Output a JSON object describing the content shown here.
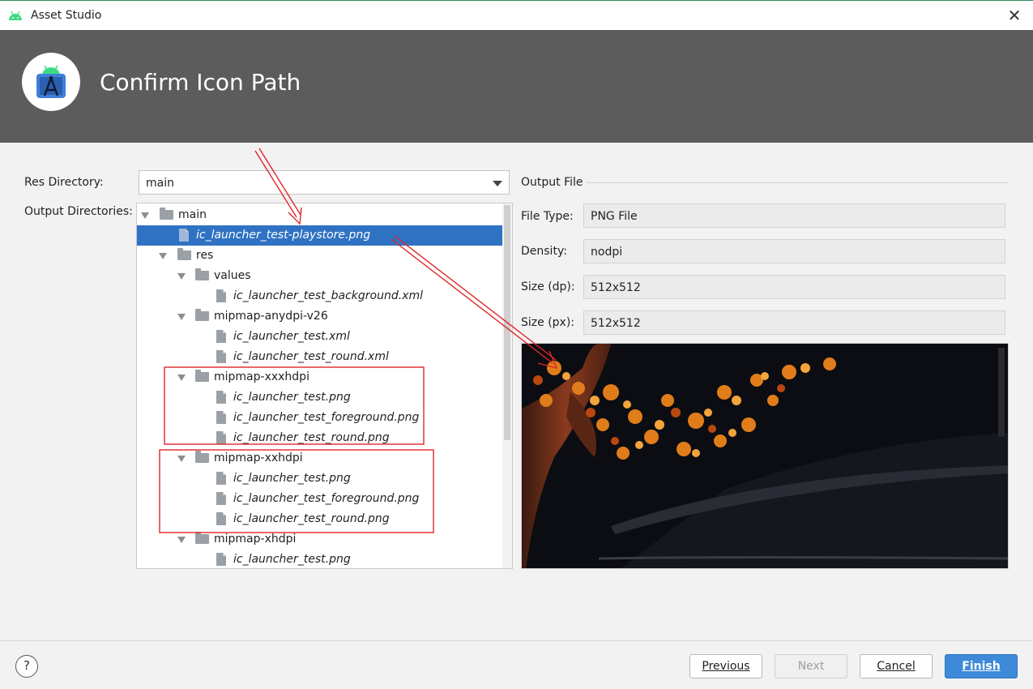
{
  "window": {
    "title": "Asset Studio",
    "close_glyph": "✕"
  },
  "banner": {
    "title": "Confirm Icon Path"
  },
  "form": {
    "res_directory_label": "Res Directory:",
    "res_directory_value": "main",
    "output_directories_label": "Output Directories:"
  },
  "tree": [
    {
      "label": "main",
      "type": "folder",
      "depth": 0,
      "expanded": true,
      "italic": false,
      "selected": false
    },
    {
      "label": "ic_launcher_test-playstore.png",
      "type": "file",
      "depth": 1,
      "italic": true,
      "selected": true
    },
    {
      "label": "res",
      "type": "folder",
      "depth": 1,
      "expanded": true,
      "italic": false,
      "selected": false
    },
    {
      "label": "values",
      "type": "folder",
      "depth": 2,
      "expanded": true,
      "italic": false,
      "selected": false
    },
    {
      "label": "ic_launcher_test_background.xml",
      "type": "file",
      "depth": 3,
      "italic": true,
      "selected": false
    },
    {
      "label": "mipmap-anydpi-v26",
      "type": "folder",
      "depth": 2,
      "expanded": true,
      "italic": false,
      "selected": false
    },
    {
      "label": "ic_launcher_test.xml",
      "type": "file",
      "depth": 3,
      "italic": true,
      "selected": false
    },
    {
      "label": "ic_launcher_test_round.xml",
      "type": "file",
      "depth": 3,
      "italic": true,
      "selected": false
    },
    {
      "label": "mipmap-xxxhdpi",
      "type": "folder",
      "depth": 2,
      "expanded": true,
      "italic": false,
      "selected": false
    },
    {
      "label": "ic_launcher_test.png",
      "type": "file",
      "depth": 3,
      "italic": true,
      "selected": false
    },
    {
      "label": "ic_launcher_test_foreground.png",
      "type": "file",
      "depth": 3,
      "italic": true,
      "selected": false
    },
    {
      "label": "ic_launcher_test_round.png",
      "type": "file",
      "depth": 3,
      "italic": true,
      "selected": false
    },
    {
      "label": "mipmap-xxhdpi",
      "type": "folder",
      "depth": 2,
      "expanded": true,
      "italic": false,
      "selected": false
    },
    {
      "label": "ic_launcher_test.png",
      "type": "file",
      "depth": 3,
      "italic": true,
      "selected": false
    },
    {
      "label": "ic_launcher_test_foreground.png",
      "type": "file",
      "depth": 3,
      "italic": true,
      "selected": false
    },
    {
      "label": "ic_launcher_test_round.png",
      "type": "file",
      "depth": 3,
      "italic": true,
      "selected": false
    },
    {
      "label": "mipmap-xhdpi",
      "type": "folder",
      "depth": 2,
      "expanded": true,
      "italic": false,
      "selected": false
    },
    {
      "label": "ic_launcher_test.png",
      "type": "file",
      "depth": 3,
      "italic": true,
      "selected": false
    }
  ],
  "output_file": {
    "header": "Output File",
    "file_type_label": "File Type:",
    "file_type_value": "PNG File",
    "density_label": "Density:",
    "density_value": "nodpi",
    "size_dp_label": "Size (dp):",
    "size_dp_value": "512x512",
    "size_px_label": "Size (px):",
    "size_px_value": "512x512"
  },
  "footer": {
    "help_glyph": "?",
    "previous_label": "Previous",
    "next_label": "Next",
    "cancel_label": "Cancel",
    "finish_label": "Finish"
  },
  "colors": {
    "selection": "#2f72c3",
    "banner": "#5c5c5c",
    "annotation_red": "#e0262b",
    "android_green": "#3ddc84",
    "primary_button": "#3c8ad8"
  },
  "icons": {
    "app": "android-icon",
    "logo": "android-studio-logo",
    "folder": "folder-icon",
    "file": "file-icon",
    "toggle": "triangle-down-icon"
  }
}
